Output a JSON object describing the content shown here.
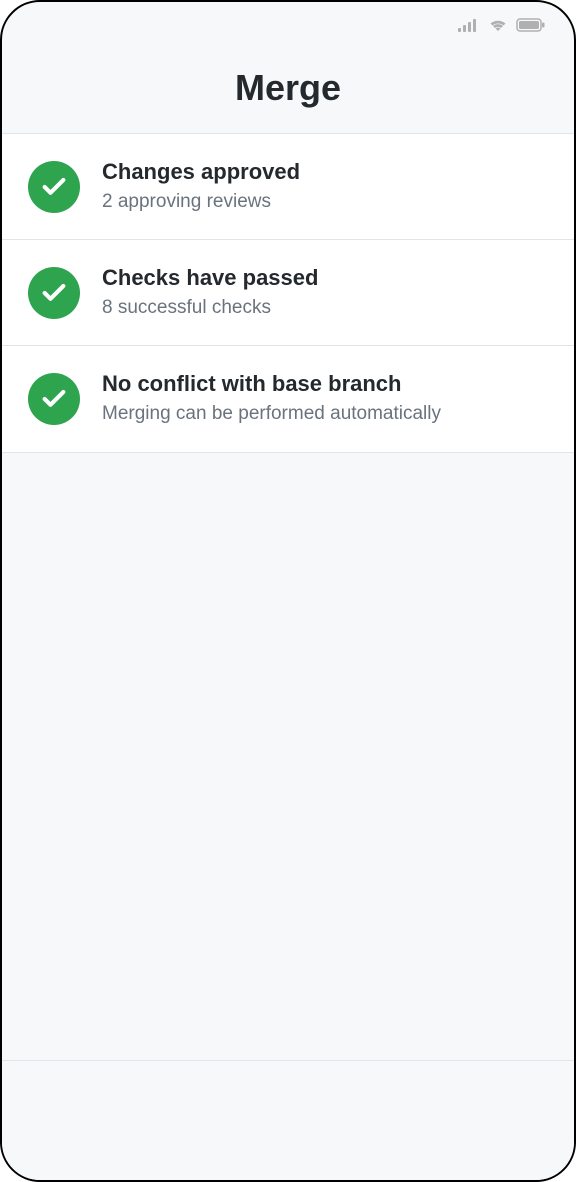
{
  "header": {
    "title": "Merge"
  },
  "status_items": [
    {
      "title": "Changes approved",
      "subtitle": "2 approving reviews"
    },
    {
      "title": "Checks have passed",
      "subtitle": "8 successful checks"
    },
    {
      "title": "No conflict with base branch",
      "subtitle": "Merging can be performed automatically"
    }
  ]
}
